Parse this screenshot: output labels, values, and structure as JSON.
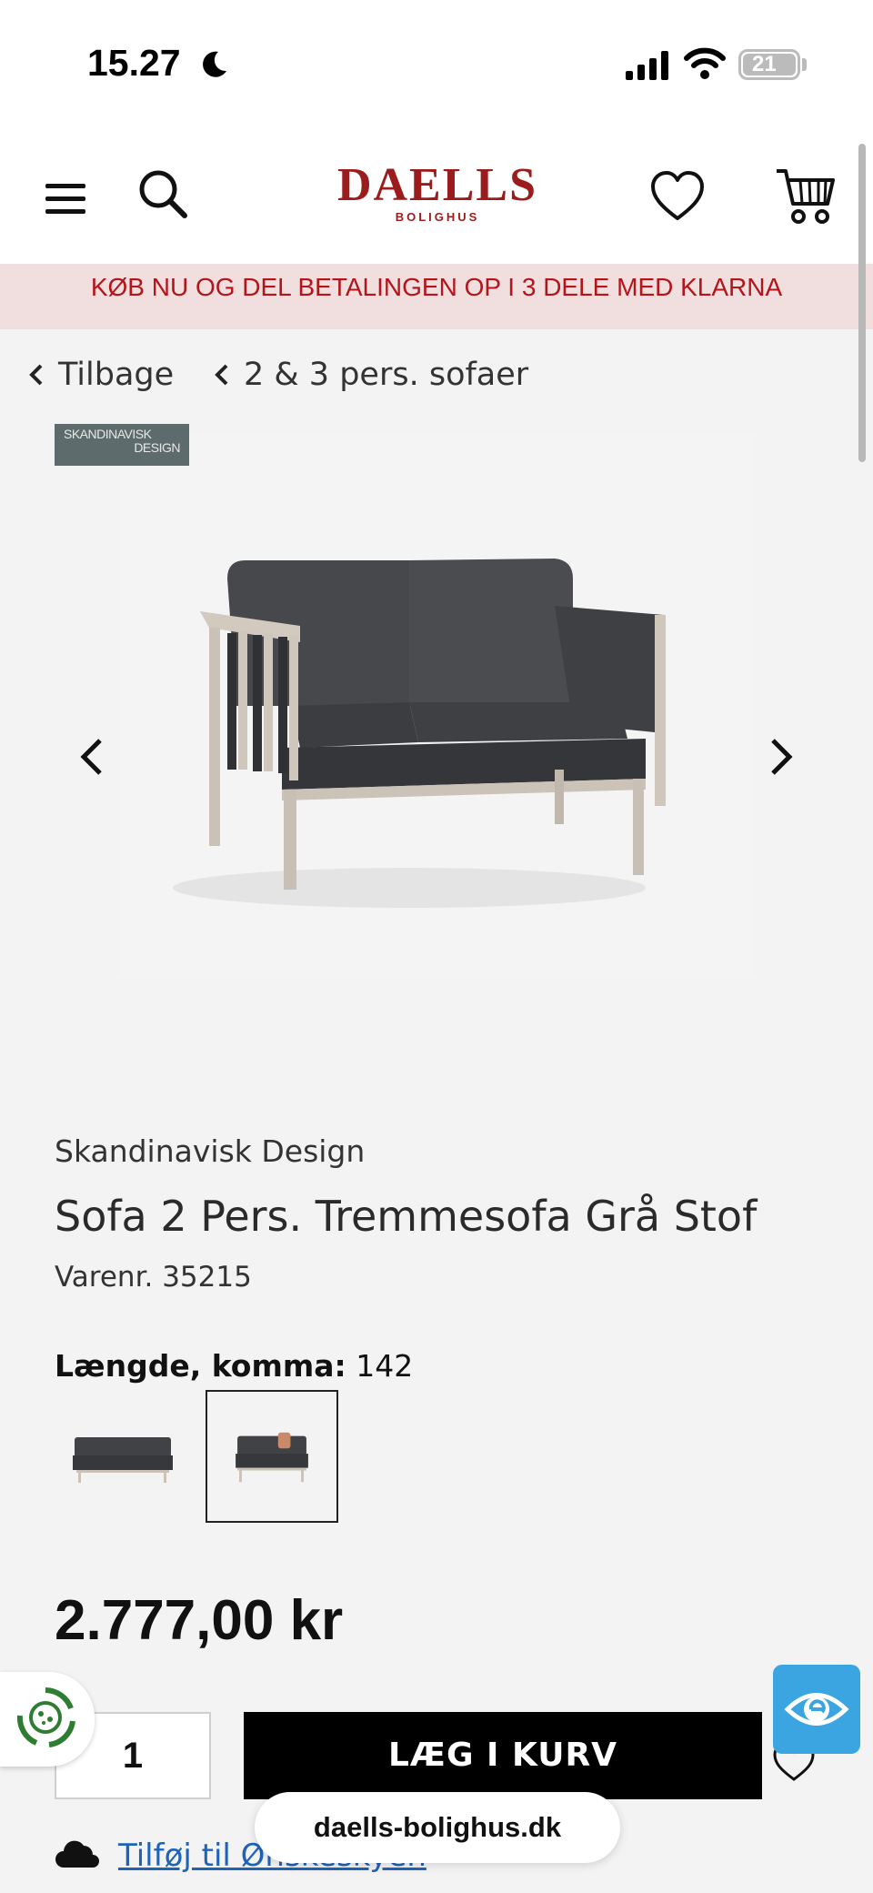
{
  "status_bar": {
    "time": "15.27",
    "battery_level": "21"
  },
  "header": {
    "logo_text": "DAELLS",
    "logo_subtext": "BOLIGHUS",
    "brand_color": "#9b1c1c"
  },
  "banner": {
    "text": "KØB NU OG DEL BETALINGEN OP I 3 DELE MED KLARNA",
    "text_color": "#b3151b",
    "background": "#f1dede"
  },
  "breadcrumb": {
    "back_label": "Tilbage",
    "category_label": "2 & 3 pers. sofaer"
  },
  "gallery": {
    "badge_line1": "SKANDINAVISK",
    "badge_line2": "DESIGN"
  },
  "product": {
    "vendor": "Skandinavisk Design",
    "title": "Sofa 2 Pers. Tremmesofa Grå Stof",
    "sku_label": "Varenr.",
    "sku": "35215",
    "variant_label": "Længde, komma:",
    "variant_value": "142",
    "price": "2.777,00 kr"
  },
  "purchase": {
    "quantity": "1",
    "add_to_cart_label": "LÆG I KURV"
  },
  "wishlist": {
    "link_label": "Tilføj til Ønskeskyen"
  },
  "browser": {
    "url": "daells-bolighus.dk"
  },
  "colors": {
    "accent_blue": "#3aa5e1",
    "link_blue": "#1f63b9",
    "cookie_green": "#2e7d32"
  }
}
